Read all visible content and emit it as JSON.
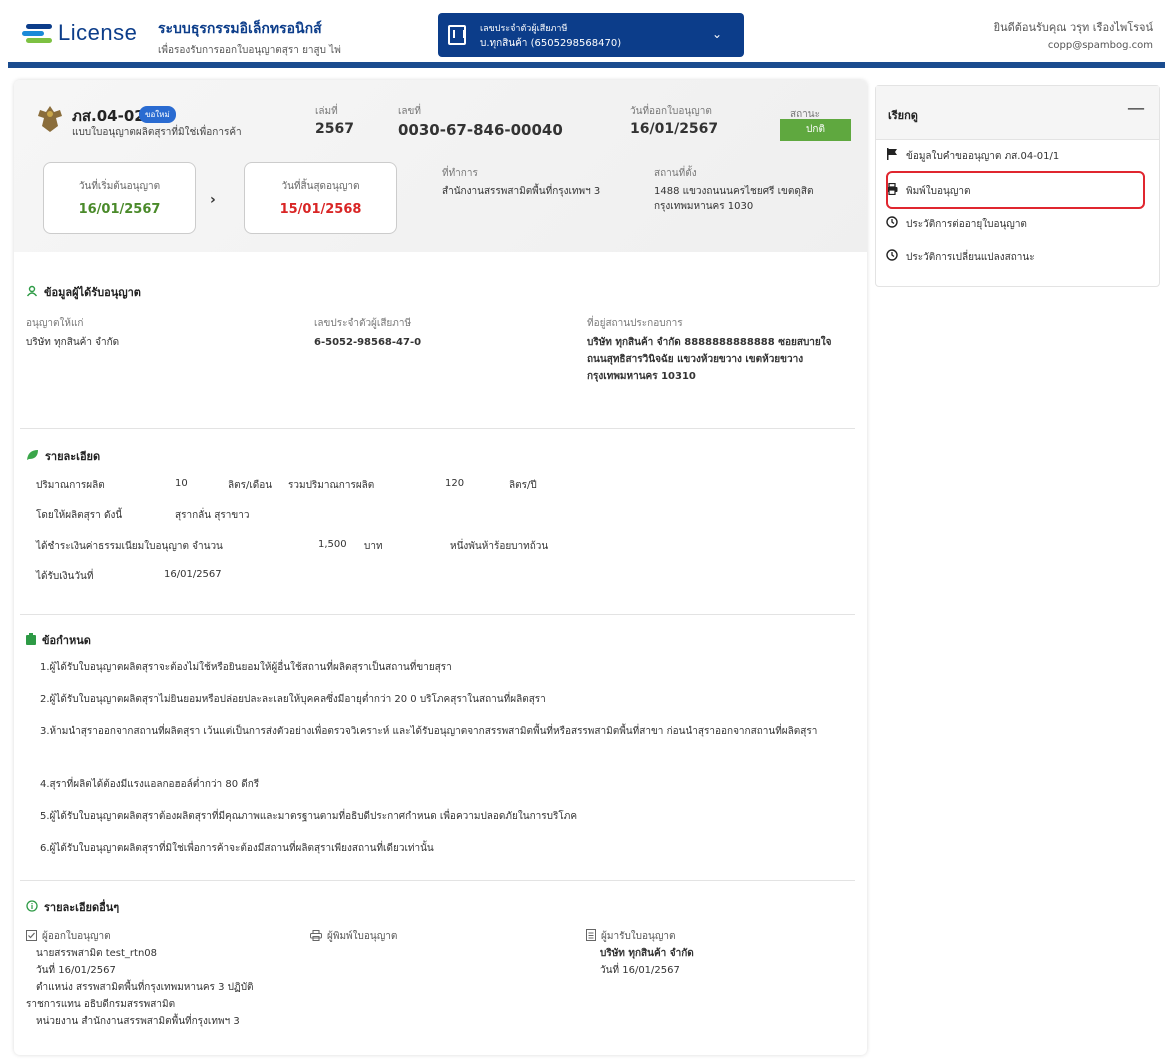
{
  "header": {
    "logo_text": "License",
    "system_title": "ระบบธุรกรรมอิเล็กทรอนิกส์",
    "system_subtitle": "เพื่อรองรับการออกใบอนุญาตสุรา ยาสูบ ไพ่",
    "tax_label": "เลขประจำตัวผู้เสียภาษี",
    "tax_value": "บ.ทุกสินค้า (6505298568470)",
    "welcome": "ยินดีต้อนรับคุณ วรุท เรืองไพโรจน์",
    "email": "copp@spambog.com"
  },
  "license": {
    "code": "ภส.04-02/1",
    "badge": "ขอใหม่",
    "subtitle": "แบบใบอนุญาตผลิตสุราที่มิใช่เพื่อการค้า",
    "book_label": "เล่มที่",
    "book_value": "2567",
    "number_label": "เลขที่",
    "number_value": "0030-67-846-00040",
    "issue_label": "วันที่ออกใบอนุญาต",
    "issue_value": "16/01/2567",
    "status_label": "สถานะ",
    "status_value": "ปกติ",
    "start_label": "วันที่เริ่มต้นอนุญาต",
    "start_value": "16/01/2567",
    "end_label": "วันที่สิ้นสุดอนุญาต",
    "end_value": "15/01/2568",
    "office_label": "ที่ทำการ",
    "office_value": "สำนักงานสรรพสามิตพื้นที่กรุงเทพฯ 3",
    "location_label": "สถานที่ตั้ง",
    "location_line1": "1488 แขวงถนนนครไชยศรี เขตดุสิต",
    "location_line2": "กรุงเทพมหานคร 1030"
  },
  "licensee": {
    "title": "ข้อมูลผู้ได้รับอนุญาต",
    "grant_label": "อนุญาตให้แก่",
    "grant_value": "บริษัท ทุกสินค้า จำกัด",
    "tax_label": "เลขประจำตัวผู้เสียภาษี",
    "tax_value": "6-5052-98568-47-0",
    "addr_label": "ที่อยู่สถานประกอบการ",
    "addr_line1": "บริษัท ทุกสินค้า จำกัด 8888888888888 ซอยสบายใจ",
    "addr_line2": "ถนนสุทธิสารวินิจฉัย แขวงห้วยขวาง เขตห้วยขวาง",
    "addr_line3": "กรุงเทพมหานคร 10310"
  },
  "details": {
    "title": "รายละเอียด",
    "qty_label": "ปริมาณการผลิต",
    "qty_value": "10",
    "qty_unit": "ลิตร/เดือน",
    "total_label": "รวมปริมาณการผลิต",
    "total_value": "120",
    "total_unit": "ลิตร/ปี",
    "type_label": "โดยให้ผลิตสุรา ดังนี้",
    "type_value": "สุรากลั่น สุราขาว",
    "fee_label": "ได้ชำระเงินค่าธรรมเนียมใบอนุญาต จำนวน",
    "fee_value": "1,500",
    "fee_unit": "บาท",
    "fee_text": "หนึ่งพันห้าร้อยบาทถ้วน",
    "paid_label": "ได้รับเงินวันที่",
    "paid_value": "16/01/2567"
  },
  "conditions": {
    "title": "ข้อกำหนด",
    "c1": "1.ผู้ได้รับใบอนุญาตผลิตสุราจะต้องไม่ใช้หรือยินยอมให้ผู้อื่นใช้สถานที่ผลิตสุราเป็นสถานที่ขายสุรา",
    "c2": "2.ผู้ได้รับใบอนุญาตผลิตสุราไม่ยินยอมหรือปล่อยปละละเลยให้บุคคลซึ่งมีอายุต่ำกว่า 20 0 บริโภคสุราในสถานที่ผลิตสุรา",
    "c3": "3.ห้ามนำสุราออกจากสถานที่ผลิตสุรา เว้นแต่เป็นการส่งตัวอย่างเพื่อตรวจวิเคราะห์ และได้รับอนุญาตจากสรรพสามิตพื้นที่หรือสรรพสามิตพื้นที่สาขา ก่อนนำสุราออกจากสถานที่ผลิตสุรา",
    "c4": "4.สุราที่ผลิตได้ต้องมีแรงแอลกอฮอล์ต่ำกว่า 80 ดีกรี",
    "c5": "5.ผู้ได้รับใบอนุญาตผลิตสุราต้องผลิตสุราที่มีคุณภาพและมาตรฐานตามที่อธิบดีประกาศกำหนด เพื่อความปลอดภัยในการบริโภค",
    "c6": "6.ผู้ได้รับใบอนุญาตผลิตสุราที่มิใช่เพื่อการค้าจะต้องมีสถานที่ผลิตสุราเพียงสถานที่เดียวเท่านั้น"
  },
  "other": {
    "title": "รายละเอียดอื่นๆ",
    "issuer_label": "ผู้ออกใบอนุญาต",
    "issuer_name": "นายสรรพสามิต test_rtn08",
    "issuer_date": "วันที่ 16/01/2567",
    "issuer_pos1": "ตำแหน่ง สรรพสามิตพื้นที่กรุงเทพมหานคร 3 ปฏิบัติ",
    "issuer_pos2": "ราชการแทน อธิบดีกรมสรรพสามิต",
    "issuer_unit": "หน่วยงาน สำนักงานสรรพสามิตพื้นที่กรุงเทพฯ 3",
    "printer_label": "ผู้พิมพ์ใบอนุญาต",
    "receiver_label": "ผู้มารับใบอนุญาต",
    "receiver_name": "บริษัท ทุกสินค้า จำกัด",
    "receiver_date": "วันที่ 16/01/2567"
  },
  "sidebar": {
    "title": "เรียกดู",
    "collapse": "—",
    "items": [
      {
        "label": "ข้อมูลใบคำขออนุญาต ภส.04-01/1",
        "icon": "flag-icon"
      },
      {
        "label": "พิมพ์ใบอนุญาต",
        "icon": "printer-icon"
      },
      {
        "label": "ประวัติการต่ออายุใบอนุญาต",
        "icon": "clock-icon"
      },
      {
        "label": "ประวัติการเปลี่ยนแปลงสถานะ",
        "icon": "clock-icon"
      }
    ]
  },
  "colors": {
    "brand": "#0c3d8a",
    "status_ok": "#5fa83f",
    "start_date": "#4a8a2a",
    "end_date": "#d92525",
    "highlight": "#e0262f"
  }
}
